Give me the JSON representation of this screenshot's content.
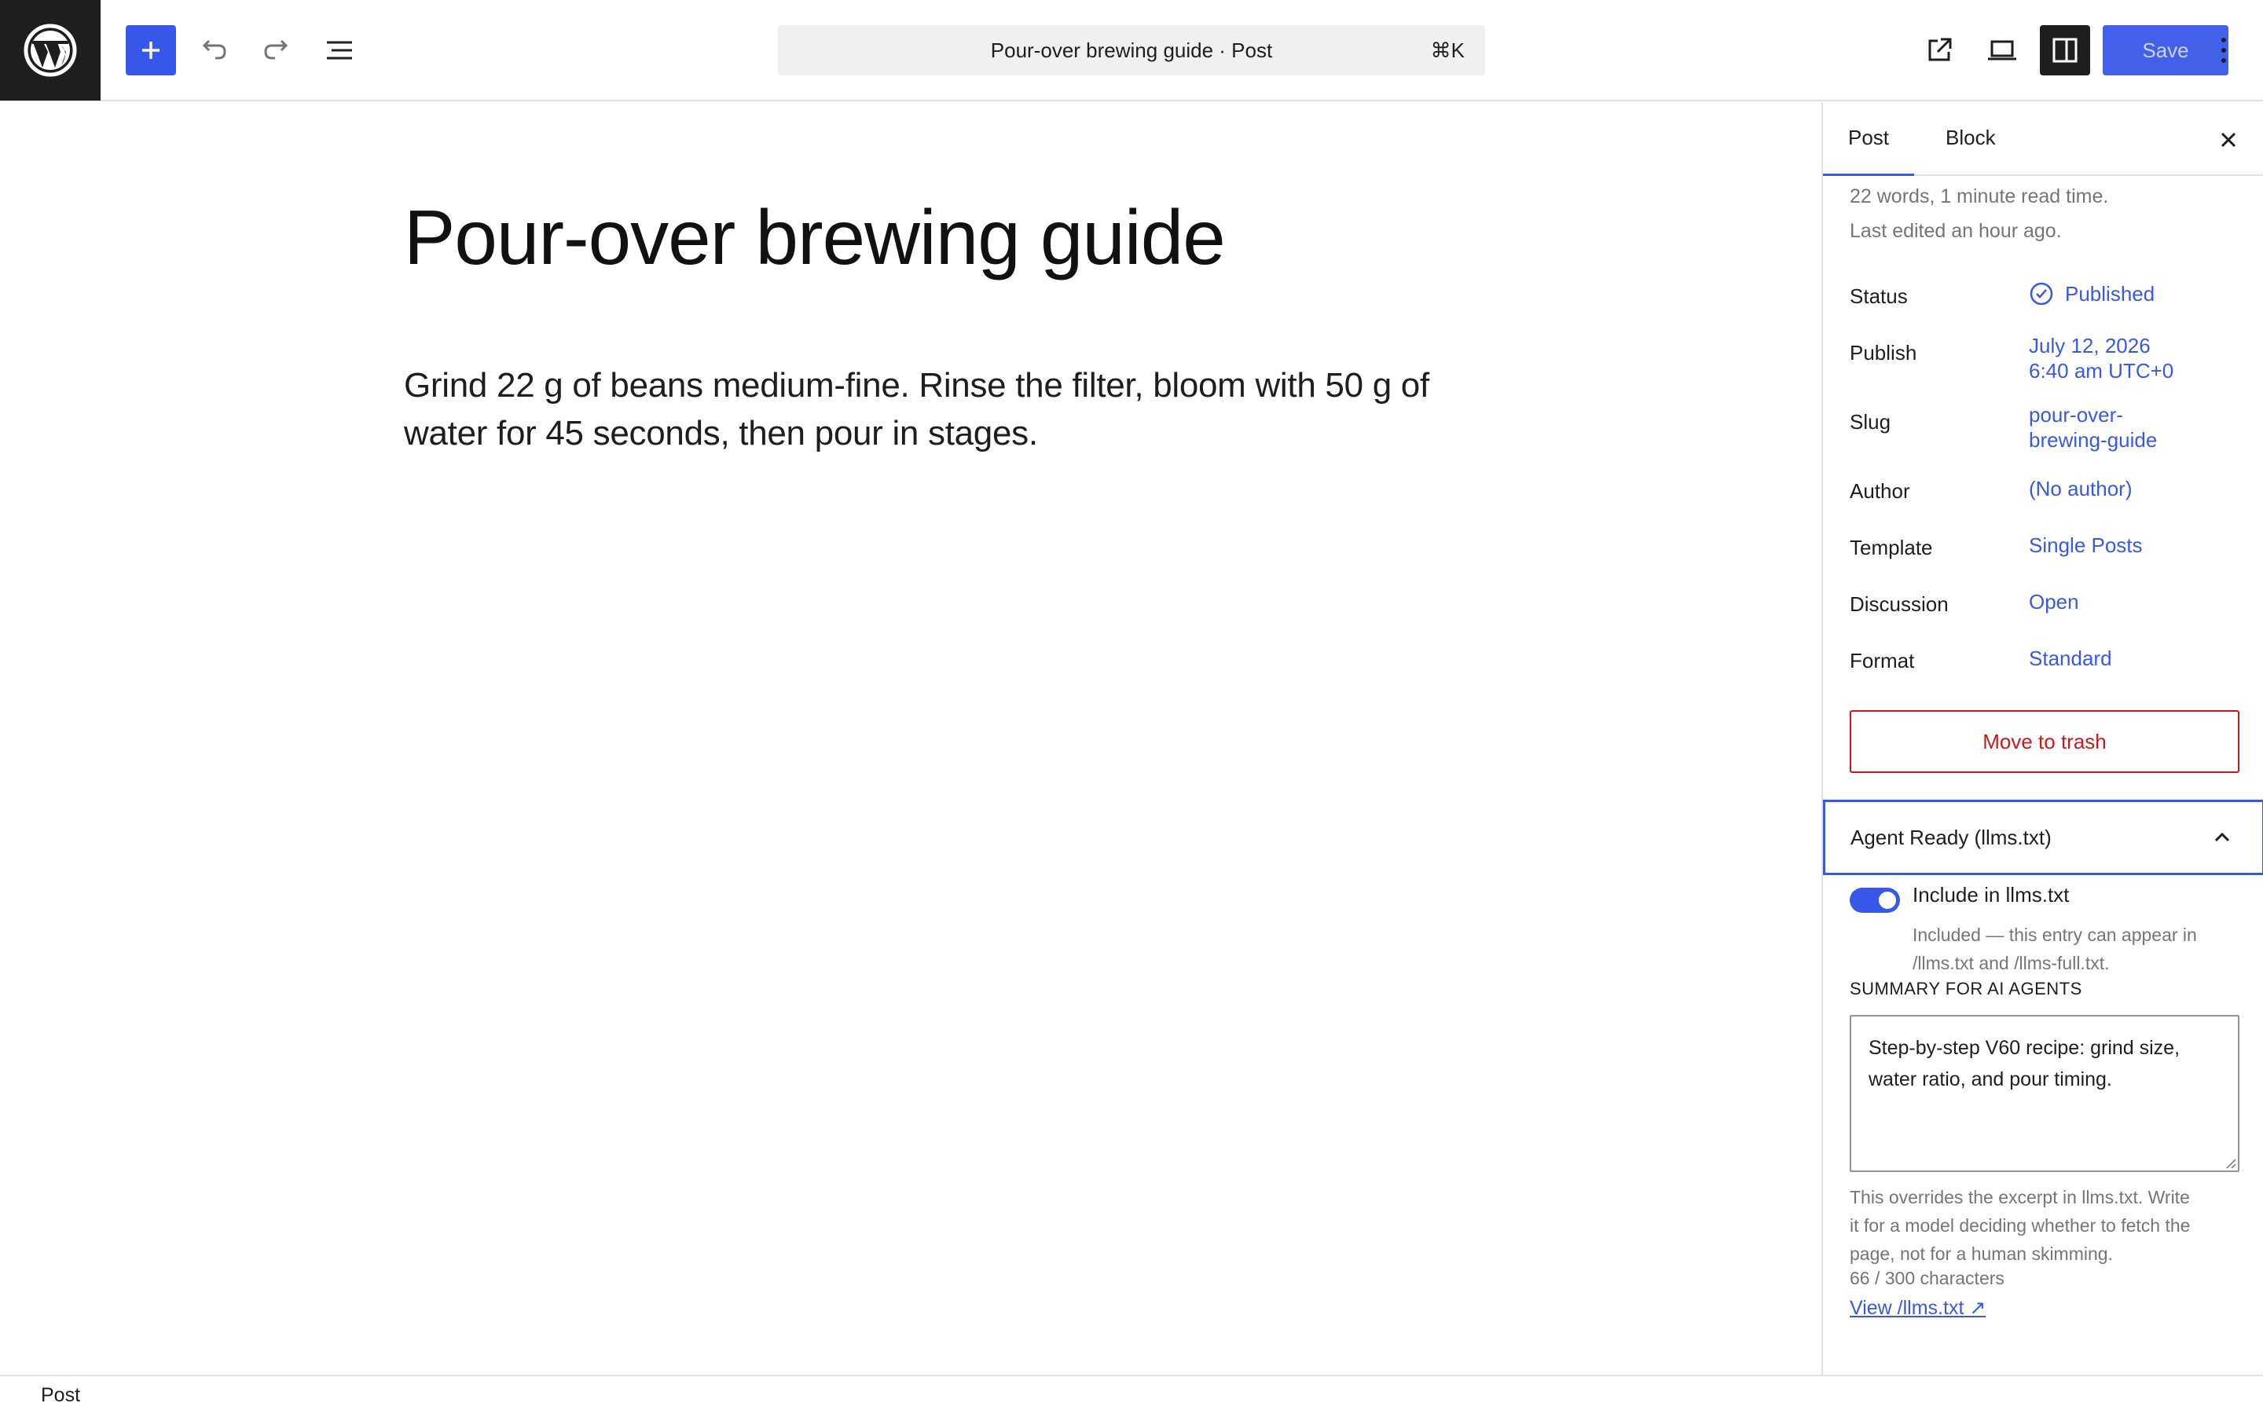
{
  "toolbar": {
    "document_title": "Pour-over brewing guide · Post",
    "shortcut": "⌘K",
    "save_label": "Save",
    "icons": [
      "wordpress-logo",
      "plus-icon",
      "undo-icon",
      "redo-icon",
      "list-view-icon",
      "external-link-icon",
      "desktop-icon",
      "sidebar-icon",
      "more-vertical-icon"
    ],
    "accent_color": "#3858e9"
  },
  "editor": {
    "title": "Pour-over brewing guide",
    "paragraph": "Grind 22 g of beans medium-fine. Rinse the filter, bloom with 50 g of water for 45 seconds, then pour in stages."
  },
  "sidebar": {
    "tabs": [
      {
        "label": "Post",
        "active": true
      },
      {
        "label": "Block",
        "active": false
      }
    ],
    "meta": {
      "words": "22 words, 1 minute read time.",
      "last_edited": "Last edited an hour ago."
    },
    "rows": {
      "status": {
        "label": "Status",
        "value": "Published"
      },
      "publish": {
        "label": "Publish",
        "value_line1": "July 12, 2026",
        "value_line2": "6:40 am UTC+0"
      },
      "slug": {
        "label": "Slug",
        "value_line1": "pour-over-",
        "value_line2": "brewing-guide"
      },
      "author": {
        "label": "Author",
        "value": "(No author)"
      },
      "template": {
        "label": "Template",
        "value": "Single Posts"
      },
      "discussion": {
        "label": "Discussion",
        "value": "Open"
      },
      "format": {
        "label": "Format",
        "value": "Standard"
      }
    },
    "trash_label": "Move to trash",
    "danger_color": "#cc1818",
    "agent_panel": {
      "title": "Agent Ready (llms.txt)",
      "expanded": true,
      "toggle_label": "Include in llms.txt",
      "toggle_on": true,
      "toggle_help_line1": "Included — this entry can appear in",
      "toggle_help_line2": "/llms.txt and /llms-full.txt.",
      "summary_label": "SUMMARY FOR AI AGENTS",
      "summary_value": "Step-by-step V60 recipe: grind size, water ratio, and pour timing.",
      "help_line1": "This overrides the excerpt in llms.txt. Write",
      "help_line2": "it for a model deciding whether to fetch the",
      "help_line3": "page, not for a human skimming.",
      "char_count": "66 / 300 characters",
      "view_link": "View /llms.txt ↗"
    }
  },
  "footer": {
    "breadcrumb": "Post"
  }
}
